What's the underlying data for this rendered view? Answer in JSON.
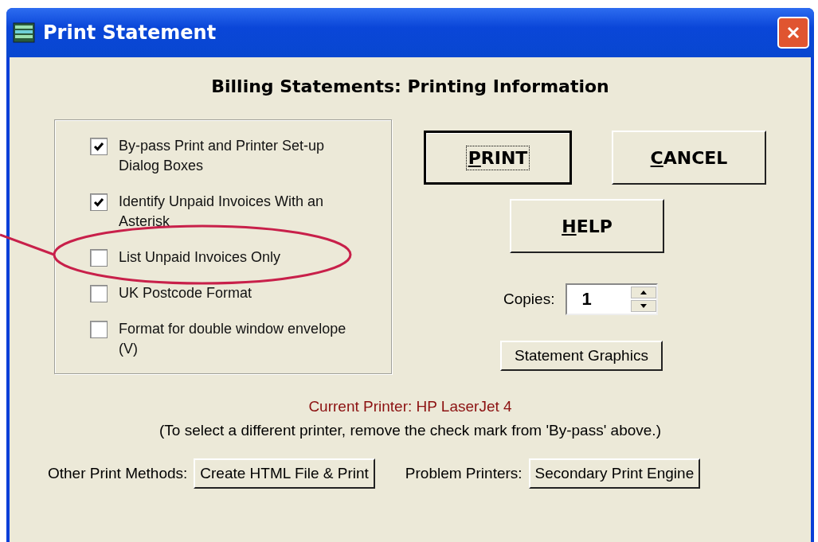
{
  "window": {
    "title": "Print Statement"
  },
  "heading": "Billing Statements: Printing Information",
  "options": [
    {
      "label": "By-pass Print and Printer Set-up Dialog Boxes",
      "checked": true
    },
    {
      "label": "Identify Unpaid Invoices With an Asterisk",
      "checked": true
    },
    {
      "label": "List Unpaid Invoices Only",
      "checked": false
    },
    {
      "label": "UK Postcode Format",
      "checked": false
    },
    {
      "label": "Format for double window envelope (V)",
      "checked": false
    }
  ],
  "main_buttons": [
    {
      "mnemonic": "P",
      "rest": "RINT",
      "focused": true
    },
    {
      "mnemonic": "C",
      "rest": "ANCEL",
      "focused": false
    },
    {
      "mnemonic": "H",
      "rest": "ELP",
      "focused": false
    }
  ],
  "copies": {
    "label": "Copies:",
    "value": "1"
  },
  "graphics_button": "Statement Graphics",
  "current_printer": "Current Printer: HP LaserJet 4",
  "note": "(To select a different printer, remove the check mark from 'By-pass' above.)",
  "footer": [
    {
      "label": "Other Print Methods:",
      "button": "Create HTML File & Print"
    },
    {
      "label": "Problem Printers:",
      "button": "Secondary Print Engine"
    }
  ]
}
